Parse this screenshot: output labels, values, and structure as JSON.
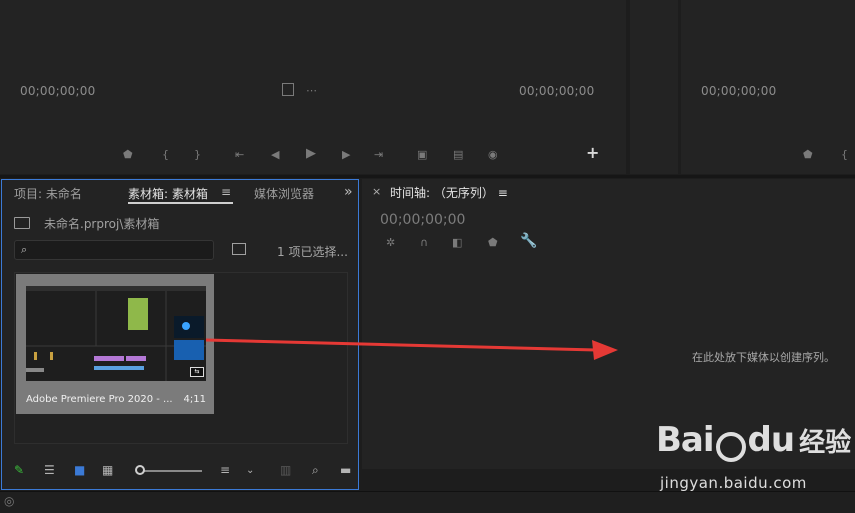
{
  "source_monitor": {
    "timecode_in": "00;00;00;00",
    "timecode_out": "00;00;00;00",
    "controls": [
      "marker-icon",
      "mark-in-icon",
      "mark-out-icon",
      "go-to-in-icon",
      "step-back-icon",
      "play-icon",
      "step-forward-icon",
      "go-to-out-icon",
      "insert-icon",
      "overwrite-icon",
      "export-frame-icon"
    ],
    "add_button": "+"
  },
  "program_monitor": {
    "timecode": "00;00;00;00"
  },
  "project_panel": {
    "tabs": [
      {
        "label": "项目: 未命名",
        "active": false
      },
      {
        "label": "素材箱: 素材箱",
        "active": true
      },
      {
        "label": "媒体浏览器",
        "active": false
      }
    ],
    "menu_glyph": "≡",
    "overflow_glyph": "»",
    "path": "未命名.prproj\\素材箱",
    "search_placeholder": "",
    "selection_status": "1 项已选择...",
    "clip": {
      "name": "Adobe Premiere Pro 2020 - ...",
      "duration": "4;11"
    }
  },
  "timeline": {
    "close_glyph": "×",
    "title": "时间轴: （无序列）",
    "menu_glyph": "≡",
    "timecode": "00;00;00;00",
    "drop_hint": "在此处放下媒体以创建序列。"
  },
  "watermark": {
    "logo_left": "Bai",
    "logo_right": "du",
    "cn": "经验",
    "url": "jingyan.baidu.com"
  },
  "colors": {
    "panel_bg": "#232323",
    "focus_border": "#3b7ad6",
    "arrow": "#e53935"
  }
}
